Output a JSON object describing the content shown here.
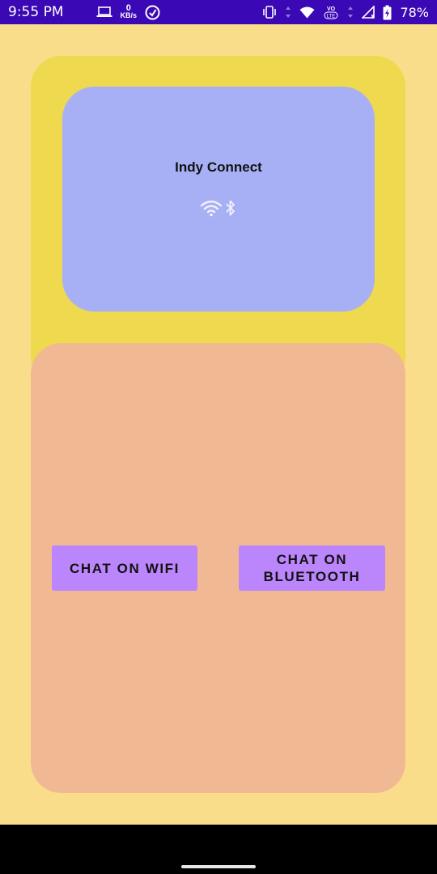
{
  "status_bar": {
    "time": "9:55 PM",
    "data_rate_value": "0",
    "data_rate_unit": "KB/s",
    "battery": "78%",
    "icons": [
      "laptop-icon",
      "data-saver-icon",
      "vibrate-icon",
      "data-arrows-icon",
      "wifi-icon",
      "volte-icon",
      "data-arrows-icon",
      "signal-icon",
      "battery-charging-icon"
    ]
  },
  "header": {
    "title": "Indy Connect",
    "icons": [
      "wifi-icon",
      "bluetooth-icon"
    ]
  },
  "actions": {
    "wifi_button": "CHAT ON WIFI",
    "bluetooth_button": "CHAT ON BLUETOOTH"
  },
  "colors": {
    "status_bar": "#3a08b4",
    "background": "#f9dd8b",
    "outer_card": "#efd94f",
    "header_card": "#a8b0f5",
    "bottom_card": "#f1b993",
    "button": "#bb86fb"
  }
}
